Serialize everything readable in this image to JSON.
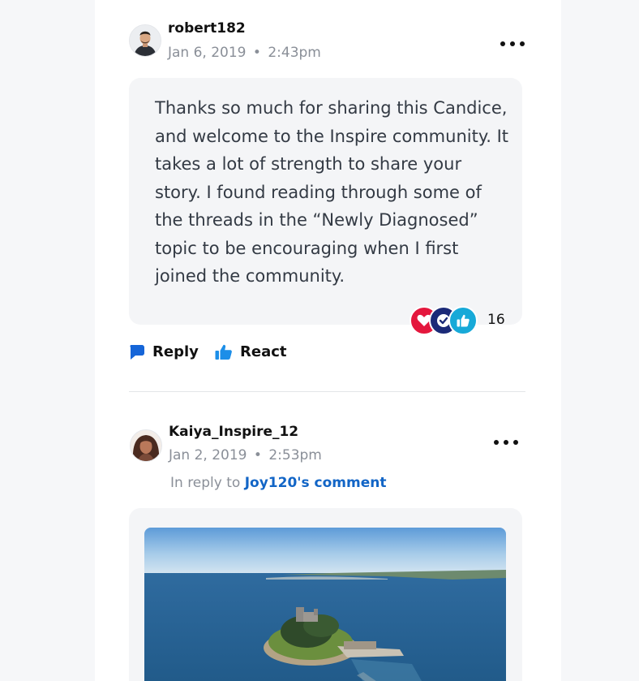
{
  "comments": [
    {
      "username": "robert182",
      "date": "Jan 6, 2019",
      "separator": "•",
      "time": "2:43pm",
      "body": "Thanks so much for sharing this Candice, and welcome to the Inspire community. It takes a lot of strength to share your story. I found reading through some of the threads in the “Newly Diagnosed” topic to be encouraging when I first joined the community.",
      "reactions": {
        "icons": [
          "heart-reaction",
          "check-reaction",
          "thumbs-up-reaction"
        ],
        "colors": [
          "#e4173d",
          "#1b2a78",
          "#17a9d8"
        ],
        "count": "16"
      },
      "actions": {
        "reply_label": "Reply",
        "react_label": "React"
      }
    },
    {
      "username": "Kaiya_Inspire_12",
      "date": "Jan 2, 2019",
      "separator": "•",
      "time": "2:53pm",
      "reply_prefix": "In reply to",
      "reply_link": "Joy120's comment"
    }
  ],
  "colors": {
    "accent": "#1265c6",
    "reply_icon": "#1565d8",
    "react_icon": "#1c8ee8",
    "muted_text": "#8a8f98",
    "bubble_bg": "#f4f5f7"
  }
}
